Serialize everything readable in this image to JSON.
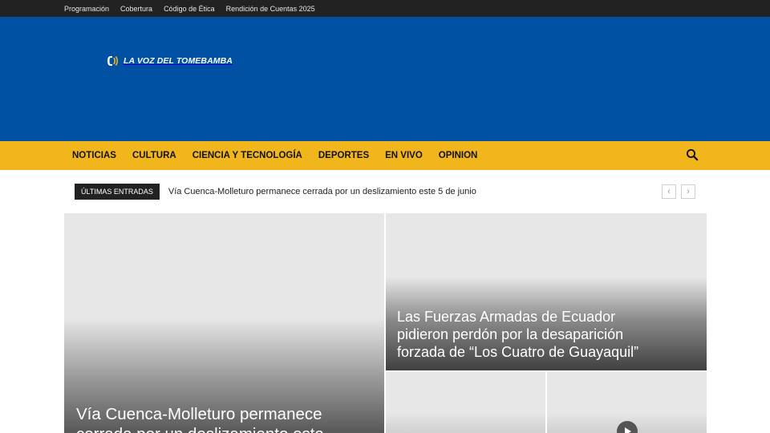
{
  "topbar": {
    "links": [
      "Programación",
      "Cobertura",
      "Código de Ética",
      "Rendición de Cuentas 2025"
    ]
  },
  "header": {
    "logo_text": "LA VOZ DEL TOMEBAMBA",
    "logo_icon": "radio-wave-logo-icon"
  },
  "nav": {
    "items": [
      "NOTICIAS",
      "CULTURA",
      "CIENCIA Y TECNOLOGÍA",
      "DEPORTES",
      "EN VIVO",
      "OPINION"
    ],
    "search_icon": "search-icon"
  },
  "ticker": {
    "label": "ÚLTIMAS ENTRADAS",
    "headline": "Vía Cuenca-Molleturo permanece cerrada por un deslizamiento este 5 de junio",
    "prev_icon": "chevron-left-icon",
    "next_icon": "chevron-right-icon",
    "prev_glyph": "‹",
    "next_glyph": "›"
  },
  "featured": {
    "main_title": "Vía Cuenca-Molleturo permanece cerrada por un deslizamiento este",
    "second_title": "Las Fuerzas Armadas de Ecuador pidieron perdón por la desaparición forzada de “Los Cuatro de Guayaquil”"
  },
  "colors": {
    "topbar": "#222222",
    "header": "#0051a3",
    "nav": "#f1b61c",
    "tile_placeholder": "#e7e7e7"
  }
}
